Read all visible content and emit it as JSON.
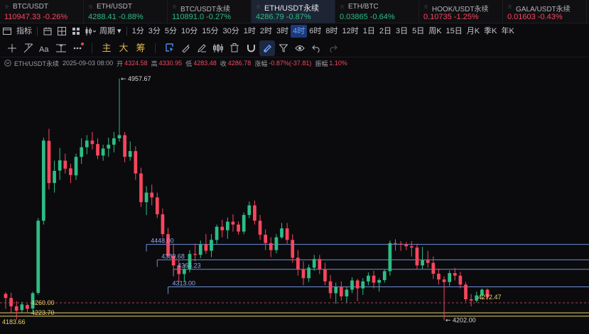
{
  "colors": {
    "up": "#2ebd85",
    "down": "#f6465d",
    "accent": "#4d8af0",
    "level_yellow": "#e8d26a"
  },
  "tickers": [
    {
      "symbol": "BTC/USDT",
      "price": "110947.33",
      "change": "-0.26%",
      "direction": "down"
    },
    {
      "symbol": "ETH/USDT",
      "price": "4288.41",
      "change": "-0.88%",
      "direction": "up"
    },
    {
      "symbol": "BTC/USDT永续",
      "price": "110891.0",
      "change": "-0.27%",
      "direction": "up"
    },
    {
      "symbol": "ETH/USDT永续",
      "price": "4286.79",
      "change": "-0.87%",
      "direction": "up",
      "active": true
    },
    {
      "symbol": "ETH/BTC",
      "price": "0.03865",
      "change": "-0.64%",
      "direction": "up"
    },
    {
      "symbol": "HOOK/USDT永续",
      "price": "0.10735",
      "change": "-1.25%",
      "direction": "down"
    },
    {
      "symbol": "GALA/USDT永续",
      "price": "0.01603",
      "change": "-0.43%",
      "direction": "down"
    }
  ],
  "interval_bar": {
    "indicator_label": "指标",
    "period_label": "周期",
    "intervals": [
      "1分",
      "3分",
      "5分",
      "10分",
      "15分",
      "30分",
      "1时",
      "2时",
      "3时",
      "4时",
      "6时",
      "8时",
      "12时",
      "1日",
      "2日",
      "3日",
      "5日",
      "周K",
      "15日",
      "月K",
      "季K",
      "年K"
    ],
    "selected": "4时"
  },
  "draw_toolbar": {
    "tools_left": [
      "crosshair-line-icon",
      "trend-line-icon",
      "text-tool-icon",
      "measure-icon",
      "more-icon"
    ],
    "text_buttons": [
      "主",
      "大",
      "筹"
    ],
    "tools_right": [
      "shape-select-icon",
      "brush-icon",
      "pencil-icon",
      "layers-icon",
      "delete-icon",
      "magnet-icon",
      "filter-icon",
      "visibility-icon",
      "undo-icon",
      "redo-icon"
    ]
  },
  "legend": {
    "symbol": "ETH/USDT永续",
    "datetime": "2025-09-03 08:00",
    "open_label": "开",
    "open": "4324.58",
    "high_label": "高",
    "high": "4330.95",
    "low_label": "低",
    "low": "4283.48",
    "close_label": "收",
    "close": "4286.78",
    "change_label": "涨幅",
    "change": "-0.87%(-37.81)",
    "amplitude_label": "振幅",
    "amplitude": "1.10%"
  },
  "chart_data": {
    "type": "candlestick",
    "ylim": [
      4175,
      4970
    ],
    "high_marker": "4957.67",
    "low_marker": "4202.00",
    "left_markers": [
      {
        "label": "4260.00",
        "value": 4255
      },
      {
        "label": "4223.70",
        "value": 4223.7
      },
      {
        "label": "4183.66",
        "value": 4195
      }
    ],
    "levels": [
      {
        "label": "4448.00",
        "value": 4438,
        "color": "#6e8fd6",
        "start": 26
      },
      {
        "label": "4389.68",
        "value": 4389.68,
        "color": "#6e8fd6",
        "start": 28
      },
      {
        "label": "4365.23",
        "value": 4360,
        "color": "#6e8fd6",
        "start": 31
      },
      {
        "label": "4313.00",
        "value": 4305,
        "color": "#6e8fd6",
        "start": 30
      }
    ],
    "current_price": {
      "label": "4272.47",
      "value": 4272.47
    },
    "dashed_line": 4255,
    "yellow_lines": [
      4223.7,
      4213
    ],
    "candles": [
      [
        4283,
        4288,
        4236,
        4270
      ],
      [
        4270,
        4286,
        4224,
        4244
      ],
      [
        4244,
        4260,
        4202,
        4230
      ],
      [
        4232,
        4258,
        4224,
        4250
      ],
      [
        4248,
        4252,
        4222,
        4236
      ],
      [
        4237,
        4290,
        4230,
        4285
      ],
      [
        4286,
        4520,
        4280,
        4512
      ],
      [
        4512,
        4772,
        4500,
        4763
      ],
      [
        4762,
        4800,
        4610,
        4630
      ],
      [
        4630,
        4700,
        4600,
        4668
      ],
      [
        4669,
        4740,
        4640,
        4701
      ],
      [
        4700,
        4722,
        4660,
        4675
      ],
      [
        4676,
        4690,
        4630,
        4655
      ],
      [
        4654,
        4722,
        4640,
        4712
      ],
      [
        4712,
        4770,
        4690,
        4742
      ],
      [
        4742,
        4780,
        4720,
        4763
      ],
      [
        4763,
        4790,
        4735,
        4752
      ],
      [
        4752,
        4770,
        4705,
        4716
      ],
      [
        4716,
        4750,
        4700,
        4738
      ],
      [
        4738,
        4772,
        4712,
        4750
      ],
      [
        4750,
        4790,
        4726,
        4770
      ],
      [
        4770,
        4957,
        4760,
        4780
      ],
      [
        4780,
        4790,
        4695,
        4712
      ],
      [
        4712,
        4760,
        4700,
        4730
      ],
      [
        4730,
        4745,
        4640,
        4660
      ],
      [
        4660,
        4678,
        4555,
        4570
      ],
      [
        4570,
        4620,
        4530,
        4600
      ],
      [
        4600,
        4625,
        4560,
        4585
      ],
      [
        4585,
        4600,
        4520,
        4532
      ],
      [
        4532,
        4550,
        4460,
        4470
      ],
      [
        4470,
        4490,
        4395,
        4402
      ],
      [
        4402,
        4440,
        4350,
        4372
      ],
      [
        4372,
        4390,
        4320,
        4345
      ],
      [
        4345,
        4375,
        4320,
        4360
      ],
      [
        4360,
        4420,
        4350,
        4408
      ],
      [
        4408,
        4440,
        4385,
        4405
      ],
      [
        4405,
        4450,
        4395,
        4438
      ],
      [
        4438,
        4470,
        4408,
        4418
      ],
      [
        4418,
        4470,
        4398,
        4452
      ],
      [
        4452,
        4500,
        4440,
        4493
      ],
      [
        4493,
        4515,
        4460,
        4482
      ],
      [
        4482,
        4522,
        4455,
        4509
      ],
      [
        4509,
        4532,
        4478,
        4500
      ],
      [
        4500,
        4510,
        4468,
        4478
      ],
      [
        4478,
        4538,
        4470,
        4530
      ],
      [
        4530,
        4572,
        4520,
        4560
      ],
      [
        4560,
        4575,
        4500,
        4512
      ],
      [
        4512,
        4530,
        4452,
        4468
      ],
      [
        4468,
        4485,
        4420,
        4442
      ],
      [
        4442,
        4460,
        4398,
        4420
      ],
      [
        4420,
        4470,
        4410,
        4460
      ],
      [
        4460,
        4505,
        4455,
        4488
      ],
      [
        4488,
        4505,
        4440,
        4452
      ],
      [
        4452,
        4470,
        4380,
        4396
      ],
      [
        4396,
        4420,
        4340,
        4360
      ],
      [
        4360,
        4385,
        4310,
        4332
      ],
      [
        4332,
        4375,
        4320,
        4365
      ],
      [
        4365,
        4405,
        4355,
        4392
      ],
      [
        4392,
        4405,
        4345,
        4360
      ],
      [
        4360,
        4380,
        4310,
        4322
      ],
      [
        4322,
        4342,
        4268,
        4285
      ],
      [
        4285,
        4318,
        4252,
        4305
      ],
      [
        4305,
        4322,
        4262,
        4275
      ],
      [
        4275,
        4305,
        4256,
        4296
      ],
      [
        4296,
        4335,
        4285,
        4325
      ],
      [
        4325,
        4330,
        4260,
        4300
      ],
      [
        4300,
        4332,
        4280,
        4322
      ],
      [
        4322,
        4350,
        4310,
        4340
      ],
      [
        4340,
        4355,
        4300,
        4318
      ],
      [
        4318,
        4332,
        4290,
        4326
      ],
      [
        4326,
        4360,
        4318,
        4354
      ],
      [
        4354,
        4450,
        4340,
        4442
      ],
      [
        4442,
        4454,
        4418,
        4440
      ],
      [
        4440,
        4448,
        4418,
        4438
      ],
      [
        4438,
        4445,
        4420,
        4432
      ],
      [
        4432,
        4448,
        4400,
        4428
      ],
      [
        4428,
        4440,
        4360,
        4372
      ],
      [
        4372,
        4430,
        4360,
        4388
      ],
      [
        4388,
        4418,
        4365,
        4380
      ],
      [
        4380,
        4400,
        4330,
        4346
      ],
      [
        4346,
        4362,
        4312,
        4328
      ],
      [
        4328,
        4338,
        4200,
        4320
      ],
      [
        4320,
        4356,
        4308,
        4348
      ],
      [
        4348,
        4364,
        4325,
        4340
      ],
      [
        4340,
        4352,
        4300,
        4312
      ],
      [
        4312,
        4320,
        4258,
        4266
      ],
      [
        4266,
        4282,
        4244,
        4262
      ],
      [
        4262,
        4290,
        4256,
        4278
      ],
      [
        4278,
        4300,
        4265,
        4296
      ],
      [
        4296,
        4300,
        4264,
        4272
      ]
    ]
  }
}
